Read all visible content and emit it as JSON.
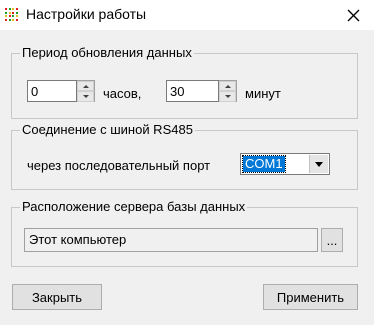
{
  "window": {
    "title": "Настройки работы",
    "close_glyph": "✕",
    "icon": "app-grid-icon",
    "icon_colors": [
      "#e02020",
      "#20a020",
      "#e0c020"
    ]
  },
  "period": {
    "legend": "Период обновления данных",
    "hours_value": "0",
    "hours_label": "часов,",
    "minutes_value": "30",
    "minutes_label": "минут"
  },
  "connection": {
    "legend": "Соединение с шиной RS485",
    "port_label": "через последовательный порт",
    "port_selected": "COM1",
    "accent": "#0078d7"
  },
  "server": {
    "legend": "Расположение сервера базы данных",
    "location_value": "Этот компьютер",
    "browse_label": "..."
  },
  "buttons": {
    "close_label": "Закрыть",
    "apply_label": "Применить"
  }
}
